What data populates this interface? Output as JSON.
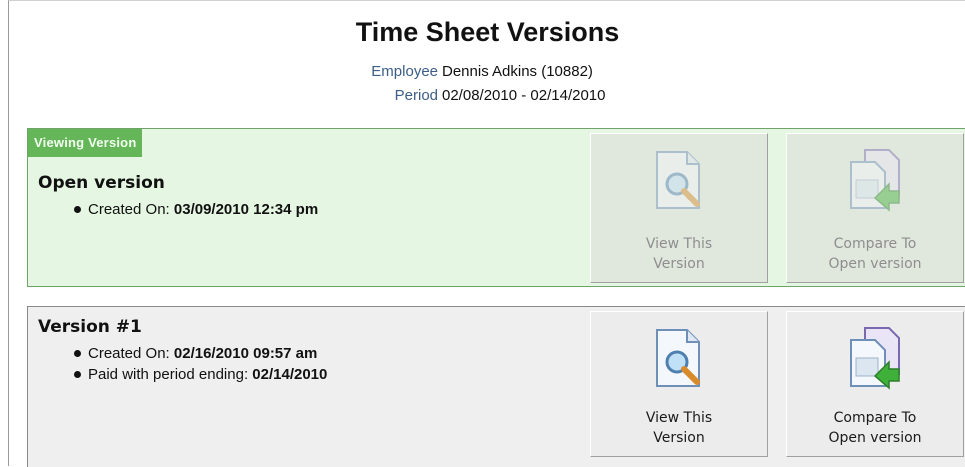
{
  "header": {
    "title": "Time Sheet Versions",
    "employee_label": "Employee",
    "employee_value": "Dennis Adkins (10882)",
    "period_label": "Period",
    "period_value": "02/08/2010 - 02/14/2010"
  },
  "viewing_panel": {
    "badge": "Viewing Version",
    "title": "Open version",
    "created_label": "Created On: ",
    "created_value": "03/09/2010 12:34 pm",
    "view_button": {
      "line1": "View This",
      "line2": "Version",
      "icon": "magnifier-document-icon"
    },
    "compare_button": {
      "line1": "Compare To",
      "line2": "Open version",
      "icon": "compare-documents-icon"
    },
    "colors": {
      "background": "#e5f7e2",
      "badge": "#64b658",
      "border": "#6fa36a"
    }
  },
  "version1_panel": {
    "title": "Version #1",
    "created_label": "Created On: ",
    "created_value": "02/16/2010 09:57 am",
    "paid_label": "Paid with period ending: ",
    "paid_value": "02/14/2010",
    "view_button": {
      "line1": "View This",
      "line2": "Version",
      "icon": "magnifier-document-icon"
    },
    "compare_button": {
      "line1": "Compare To",
      "line2": "Open version",
      "icon": "compare-documents-icon"
    },
    "colors": {
      "background": "#efefef"
    }
  }
}
